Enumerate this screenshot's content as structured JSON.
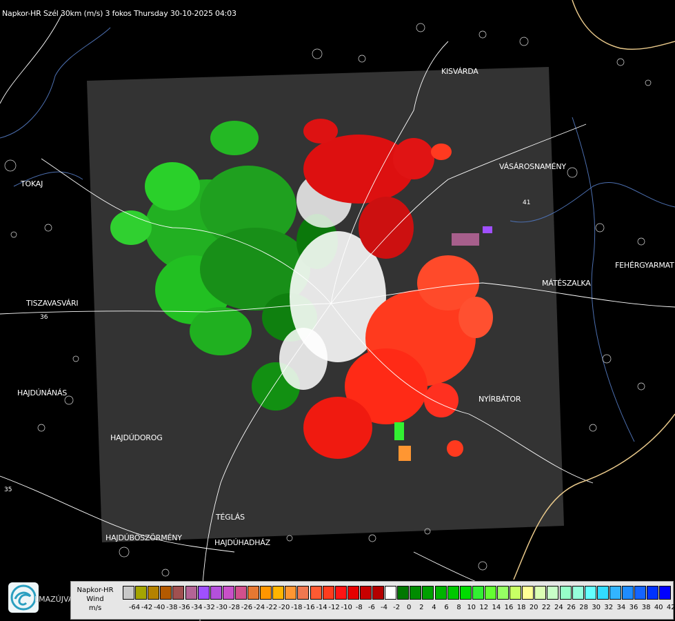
{
  "title": "Napkor-HR Szél 30km (m/s) 3 fokos Thursday 30-10-2025 04:03",
  "places": [
    {
      "id": "kisvarda",
      "label": "KISVÁRDA"
    },
    {
      "id": "vasarosnameny",
      "label": "VÁSÁROSNAMÉNY"
    },
    {
      "id": "tokaj",
      "label": "TOKAJ"
    },
    {
      "id": "fehergyarmat",
      "label": "FEHÉRGYARMAT"
    },
    {
      "id": "mateszalka",
      "label": "MÁTÉSZALKA"
    },
    {
      "id": "tiszavasvari",
      "label": "TISZAVASVÁRI"
    },
    {
      "id": "hajdunanas",
      "label": "HAJDÚNÁNÁS"
    },
    {
      "id": "nyirbator",
      "label": "NYÍRBÁTOR"
    },
    {
      "id": "hajdudorog",
      "label": "HAJDÚDOROG"
    },
    {
      "id": "teglas",
      "label": "TÉGLÁS"
    },
    {
      "id": "hajduboszormeny",
      "label": "HAJDÚBÖSZÖRMÉNY"
    },
    {
      "id": "hajduhadhaz",
      "label": "HAJDÚHADHÁZ"
    }
  ],
  "road_numbers": [
    "36",
    "41",
    "35"
  ],
  "legend": {
    "line1": "Napkor-HR",
    "line2": "Wind",
    "line3": "m/s",
    "values": [
      "-64",
      "-42",
      "-40",
      "-38",
      "-36",
      "-34",
      "-32",
      "-30",
      "-28",
      "-26",
      "-24",
      "-22",
      "-20",
      "-18",
      "-16",
      "-14",
      "-12",
      "-10",
      "-8",
      "-6",
      "-4",
      "-2",
      "0",
      "2",
      "4",
      "6",
      "8",
      "10",
      "12",
      "14",
      "16",
      "18",
      "20",
      "22",
      "24",
      "26",
      "28",
      "30",
      "32",
      "34",
      "36",
      "38",
      "40",
      "42"
    ],
    "colors": [
      "#c8c8c8",
      "#a5a500",
      "#b48200",
      "#b45a00",
      "#a05050",
      "#b46496",
      "#a050ff",
      "#b450dc",
      "#c850c8",
      "#d2508c",
      "#e67832",
      "#ff9600",
      "#ffb400",
      "#ff9632",
      "#f07850",
      "#ff5a32",
      "#ff3c1e",
      "#ff1414",
      "#e60000",
      "#c80000",
      "#b40000",
      "#ffffff",
      "#007800",
      "#008c00",
      "#00a000",
      "#00b400",
      "#00c800",
      "#00dc00",
      "#32f032",
      "#64ff32",
      "#96ff64",
      "#c8ff64",
      "#ffff96",
      "#dcffb4",
      "#c8ffc8",
      "#96ffc8",
      "#96ffdc",
      "#64ffff",
      "#32dcff",
      "#32b4ff",
      "#1e8cff",
      "#1464ff",
      "#0032ff",
      "#0000ff"
    ]
  },
  "logo_text": "LMAZÚJVÁR"
}
